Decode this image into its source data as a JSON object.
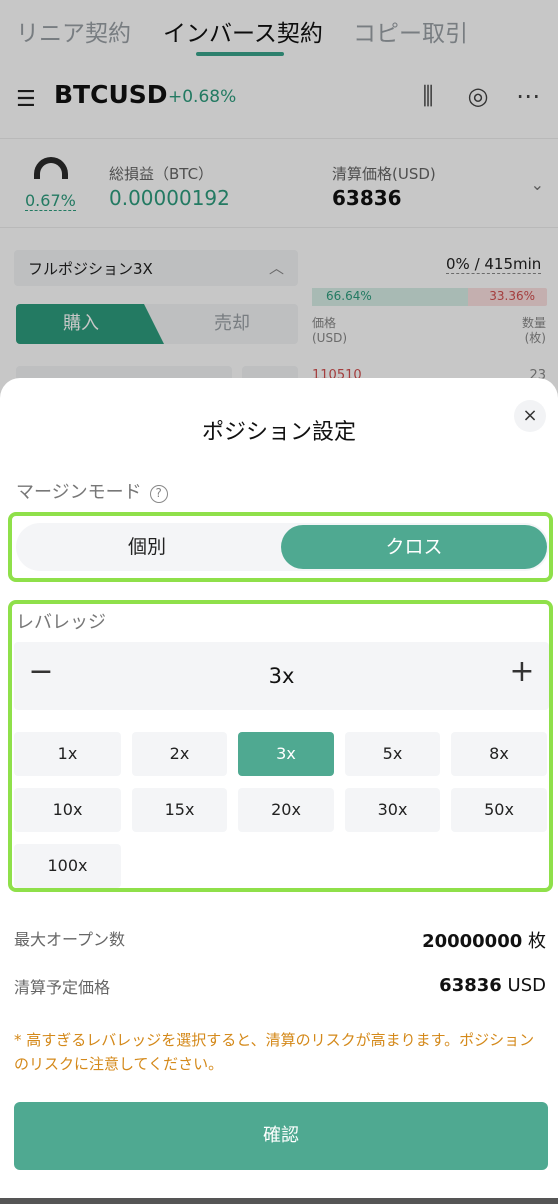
{
  "header": {
    "tabs": [
      {
        "label": "リニア契約"
      },
      {
        "label": "インバース契約"
      },
      {
        "label": "コピー取引"
      }
    ]
  },
  "pair": {
    "menu_icon": "list-menu-icon",
    "symbol": "BTCUSD",
    "change": "+0.68%",
    "icons": [
      "candlestick-icon",
      "settings-icon",
      "more-icon"
    ]
  },
  "pnl_card": {
    "gauge_pct": "0.67%",
    "pnl_label": "総損益（BTC）",
    "pnl_value": "0.00000192",
    "liq_label": "清算価格(USD)",
    "liq_value": "63836"
  },
  "order_panel": {
    "position_mode": "フルポジション3X",
    "buy_label": "購入",
    "sell_label": "売却",
    "ob_time": "0% / 415min",
    "buy_pct": "66.64%",
    "sell_pct": "33.36%",
    "price_header": "価格",
    "price_unit": "(USD)",
    "qty_header": "数量",
    "qty_unit": "(枚)",
    "first_price": "110510",
    "first_qty": "23"
  },
  "sheet": {
    "title": "ポジション設定",
    "close_label": "×",
    "margin_mode_label": "マージンモード",
    "margin_options": {
      "isolated": "個別",
      "cross": "クロス"
    },
    "selected_margin": "cross",
    "leverage_label": "レバレッジ",
    "leverage_value": "3x",
    "minus_label": "−",
    "plus_label": "+",
    "leverage_options": [
      "1x",
      "2x",
      "3x",
      "5x",
      "8x",
      "10x",
      "15x",
      "20x",
      "30x",
      "50x",
      "100x"
    ],
    "selected_leverage": "3x",
    "max_open_label": "最大オープン数",
    "max_open_value": "20000000",
    "max_open_unit": "枚",
    "est_liq_label": "清算予定価格",
    "est_liq_value": "63836",
    "est_liq_unit": "USD",
    "warning": "* 高すぎるレバレッジを選択すると、清算のリスクが高まります。ポジションのリスクに注意してください。",
    "confirm_label": "確認"
  },
  "colors": {
    "accent": "#4fa991",
    "positive": "#2e9d7e",
    "negative": "#d24f4f",
    "warning": "#d4891a",
    "highlight": "#8fe04a"
  }
}
